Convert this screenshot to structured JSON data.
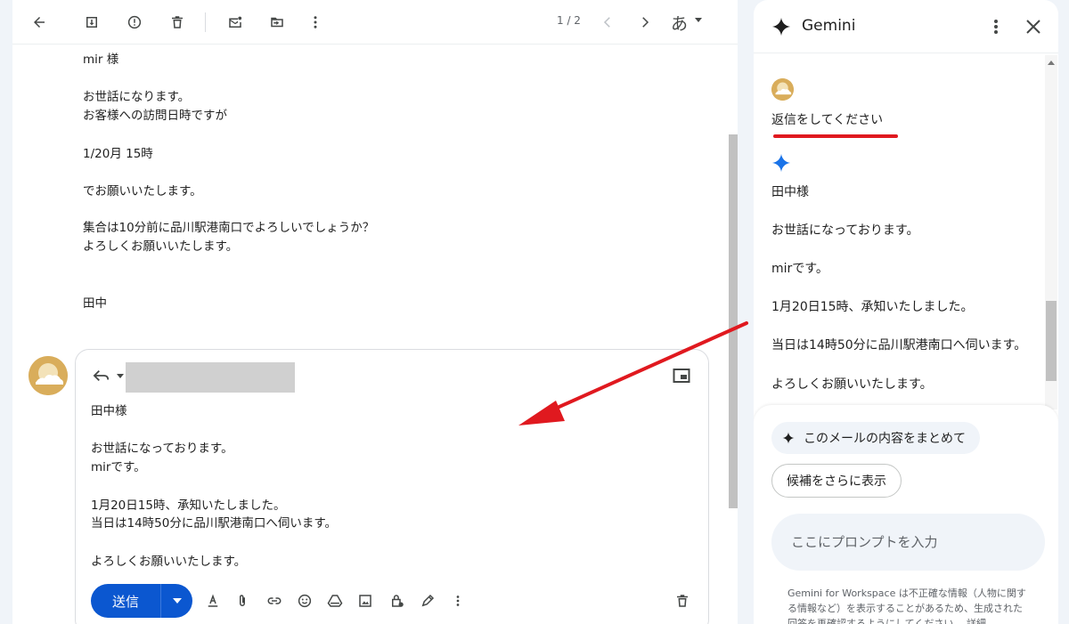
{
  "toolbar": {
    "pager": "1 / 2",
    "lang_label": "あ"
  },
  "email": {
    "greeting": "mir 様",
    "line1": "お世話になります。",
    "line2": "お客様への訪問日時ですが",
    "line3": "1/20月 15時",
    "line4": "でお願いいたします。",
    "line5": "集合は10分前に品川駅港南口でよろしいでしょうか？",
    "line6": "よろしくお願いいたします。",
    "signature": "田中"
  },
  "reply": {
    "line1": "田中様",
    "line2": "お世話になっております。",
    "line3": "mirです。",
    "line4": "1月20日15時、承知いたしました。",
    "line5": "当日は14時50分に品川駅港南口へ伺います。",
    "line6": "よろしくお願いいたします。",
    "send_label": "送信"
  },
  "gemini": {
    "title": "Gemini",
    "user_prompt": "返信をしてください",
    "response": [
      "田中様",
      "お世話になっております。",
      "mirです。",
      "1月20日15時、承知いたしました。",
      "当日は14時50分に品川駅港南口へ伺います。",
      "よろしくお願いいたします。"
    ],
    "chip_summarize": "このメールの内容をまとめて",
    "chip_more": "候補をさらに表示",
    "input_placeholder": "ここにプロンプトを入力",
    "disclaimer": "Gemini for Workspace は不正確な情報（人物に関する情報など）を表示することがあるため、生成された回答を再確認するようにしてください。 詳細"
  },
  "colors": {
    "send_blue": "#0b57d0",
    "annotation_red": "#e0191f",
    "avatar_gold": "#d9ad5b",
    "gemini_blue": "#1a73e8"
  }
}
